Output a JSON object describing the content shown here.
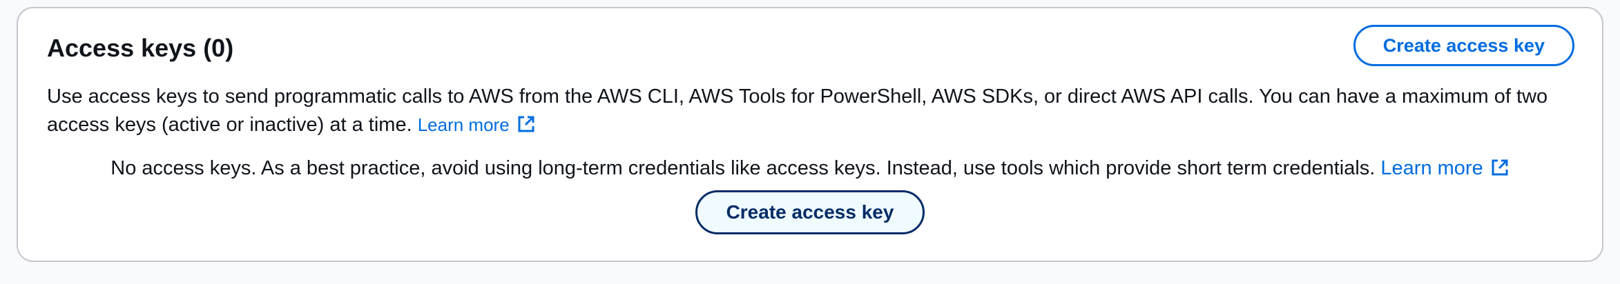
{
  "panel": {
    "title": "Access keys (0)",
    "header_button_label": "Create access key",
    "description": "Use access keys to send programmatic calls to AWS from the AWS CLI, AWS Tools for PowerShell, AWS SDKs, or direct AWS API calls. You can have a maximum of two access keys (active or inactive) at a time.",
    "description_link": "Learn more",
    "empty_text": "No access keys. As a best practice, avoid using long-term credentials like access keys. Instead, use tools which provide short term credentials.",
    "empty_link": "Learn more",
    "empty_button_label": "Create access key"
  },
  "icons": {
    "external_link": "external-link-icon"
  },
  "colors": {
    "link": "#006ce0",
    "primary_dark": "#002b66",
    "border": "#c6c6cd",
    "text": "#0f141a"
  }
}
